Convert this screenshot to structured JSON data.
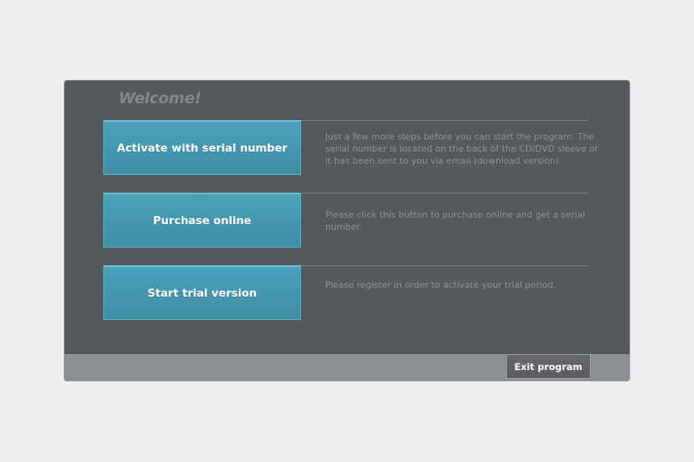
{
  "welcome": {
    "title": "Welcome!"
  },
  "options": [
    {
      "label": "Activate with serial number",
      "description": "Just a few more steps before you can start the program. The serial number is located on the back of the CD/DVD sleeve or it has been sent to you via email (download version)."
    },
    {
      "label": "Purchase online",
      "description": "Please click this button to purchase online and get a serial number."
    },
    {
      "label": "Start trial version",
      "description": "Please register in order to activate your trial period."
    }
  ],
  "footer": {
    "exit_label": "Exit program"
  },
  "colors": {
    "panel_background": "#55585d",
    "footer_background": "#8b8e93",
    "button_accent": "#4aa1bb",
    "page_background": "#eeeeee"
  }
}
